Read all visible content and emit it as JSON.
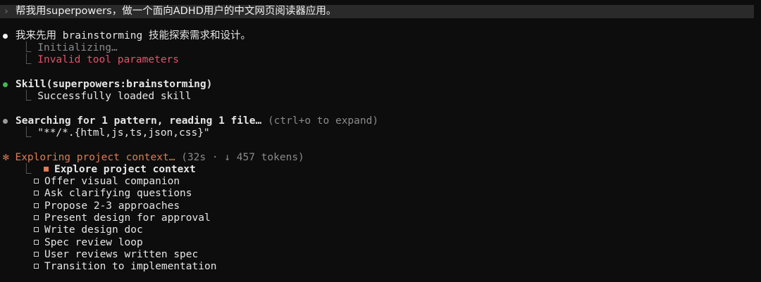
{
  "colors": {
    "background": "#0d0d0d",
    "prompt_bar": "#2a2a2a",
    "error": "#e8506a",
    "success_dot": "#3fb950",
    "neutral_dot": "#9a9a9a",
    "accent": "#e07b53"
  },
  "prompt": {
    "chevron": "›",
    "text": "帮我用superpowers，做一个面向ADHD用户的中文网页阅读器应用。"
  },
  "block1": {
    "title": "我来先用 brainstorming 技能探索需求和设计。",
    "sub1": "Initializing…",
    "sub2": "Invalid tool parameters"
  },
  "block2": {
    "title": "Skill(superpowers:brainstorming)",
    "sub1": "Successfully loaded skill"
  },
  "block3": {
    "title": "Searching for 1 pattern, reading 1 file…",
    "hint": "(ctrl+o to expand)",
    "sub1": "\"**/*.{html,js,ts,json,css}\""
  },
  "block4": {
    "spinner": "✻",
    "title": "Exploring project context…",
    "meta": "(32s · ↓ 457 tokens)",
    "tasks": [
      "Explore project context",
      "Offer visual companion",
      "Ask clarifying questions",
      "Propose 2-3 approaches",
      "Present design for approval",
      "Write design doc",
      "Spec review loop",
      "User reviews written spec",
      "Transition to implementation"
    ]
  }
}
